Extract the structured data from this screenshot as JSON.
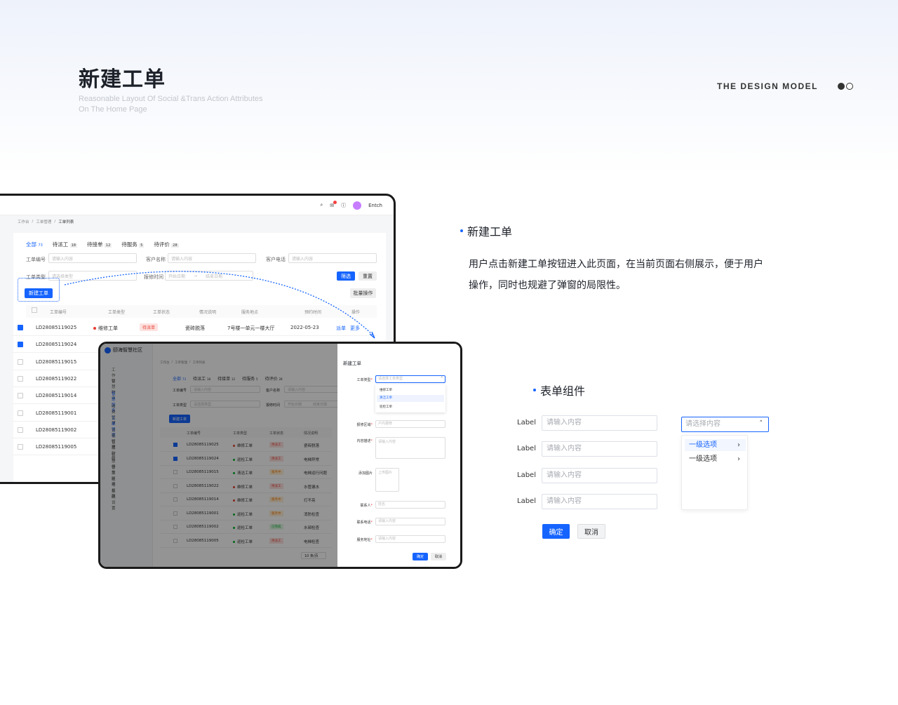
{
  "header": {
    "title": "新建工单",
    "subtitle_line1": "Reasonable Layout Of Social &Trans Action Attributes",
    "subtitle_line2": "On The Home Page",
    "brand": "THE DESIGN MODEL",
    "brand_dot_colors": [
      "#333333",
      "#ffffff"
    ]
  },
  "section1": {
    "title": "新建工单",
    "desc_line1": "用户点击新建工单按钮进入此页面，在当前页面右侧展示，便于用户",
    "desc_line2": "操作，同时也规避了弹窗的局限性。"
  },
  "section2": {
    "title": "表单组件"
  },
  "colors": {
    "accent": "#1664ff"
  },
  "screen1": {
    "user": "Entch",
    "breadcrumb": [
      "工作台",
      "工单管理",
      "工单列表"
    ],
    "tabs": [
      {
        "label": "全部",
        "count": "73"
      },
      {
        "label": "待派工",
        "count": "18"
      },
      {
        "label": "待接单",
        "count": "12"
      },
      {
        "label": "待服务",
        "count": "5"
      },
      {
        "label": "待评价",
        "count": "28"
      }
    ],
    "filters": {
      "order_no": "工单编号",
      "customer": "客户名称",
      "phone": "客户电话",
      "type": "工单类型",
      "time": "报修时间",
      "placeholder": "请输入内容",
      "select_placeholder": "请选择类型",
      "start": "开始日期",
      "end": "结束日期",
      "sep": "→"
    },
    "buttons": {
      "filter": "筛选",
      "reset": "重置",
      "new": "新建工单",
      "batch": "批量操作"
    },
    "columns": [
      "工单编号",
      "工单类型",
      "工单状态",
      "情况说明",
      "服务地点",
      "预约时间",
      "操作"
    ],
    "rows": [
      {
        "id": "LD28085119025",
        "type": "维修工单",
        "status": "待派单",
        "desc": "瓷砖脱落",
        "place": "7号楼一单元一楼大厅",
        "date": "2022-05-23",
        "op1": "派单",
        "op2": "更多",
        "checked": true
      },
      {
        "id": "LD28085119024",
        "checked": true
      },
      {
        "id": "LD28085119015",
        "checked": false
      },
      {
        "id": "LD28085119022",
        "checked": false
      },
      {
        "id": "LD28085119014",
        "checked": false
      },
      {
        "id": "LD28085119001",
        "checked": false
      },
      {
        "id": "LD28085119002",
        "checked": false
      },
      {
        "id": "LD28085119005",
        "checked": false
      }
    ]
  },
  "screen2": {
    "app": "颐海智慧社区",
    "nav": [
      "工作台",
      "智慧物业",
      "智慧服务",
      "收费管理",
      "工单管理",
      "访客管理",
      "智慧物联",
      "智慧停车",
      "智慧环境",
      "账号权限",
      "系统设置"
    ],
    "breadcrumb": [
      "工作台",
      "工单管理",
      "工单列表"
    ],
    "tabs": [
      {
        "label": "全部",
        "count": "73"
      },
      {
        "label": "待派工",
        "count": "18"
      },
      {
        "label": "待接单",
        "count": "12"
      },
      {
        "label": "待服务",
        "count": "5"
      },
      {
        "label": "待评价",
        "count": "28"
      }
    ],
    "filters": {
      "order_no": "工单编号",
      "customer": "客户名称",
      "type": "工单类型",
      "time": "报修时间",
      "placeholder": "请输入内容",
      "select_placeholder": "请选择类型",
      "start": "开始日期",
      "end": "结束日期"
    },
    "new_button": "新建工单",
    "columns": [
      "工单编号",
      "工单类型",
      "工单状态",
      "情况说明"
    ],
    "rows": [
      {
        "id": "LD28085119025",
        "type": "维修工单",
        "status": "待派工",
        "desc": "瓷砖脱落",
        "checked": true,
        "dot": "#e63f32",
        "tag_bg": "#fde2e0",
        "tag_fg": "#e63f32"
      },
      {
        "id": "LD28085119024",
        "type": "巡检工单",
        "status": "待派工",
        "desc": "电梯异常",
        "checked": true,
        "dot": "#00b42a",
        "tag_bg": "#fde2e0",
        "tag_fg": "#e63f32"
      },
      {
        "id": "LD28085119015",
        "type": "清洁工单",
        "status": "服务中",
        "desc": "电梯运行问题",
        "checked": false,
        "dot": "#00b42a",
        "tag_bg": "#fff0d6",
        "tag_fg": "#ff7d00"
      },
      {
        "id": "LD28085119022",
        "type": "维修工单",
        "status": "待派工",
        "desc": "水管漏水",
        "checked": false,
        "dot": "#e63f32",
        "tag_bg": "#fde2e0",
        "tag_fg": "#e63f32"
      },
      {
        "id": "LD28085119014",
        "type": "维修工单",
        "status": "服务中",
        "desc": "灯不亮",
        "checked": false,
        "dot": "#e63f32",
        "tag_bg": "#fff0d6",
        "tag_fg": "#ff7d00"
      },
      {
        "id": "LD28085119001",
        "type": "巡检工单",
        "status": "服务中",
        "desc": "消防检查",
        "checked": false,
        "dot": "#00b42a",
        "tag_bg": "#fff0d6",
        "tag_fg": "#ff7d00"
      },
      {
        "id": "LD28085119002",
        "type": "巡检工单",
        "status": "已完成",
        "desc": "水阀检查",
        "checked": false,
        "dot": "#00b42a",
        "tag_bg": "#e3f7e6",
        "tag_fg": "#00b42a"
      },
      {
        "id": "LD28085119005",
        "type": "巡检工单",
        "status": "待派工",
        "desc": "电梯检查",
        "checked": false,
        "dot": "#00b42a",
        "tag_bg": "#fde2e0",
        "tag_fg": "#e63f32"
      }
    ],
    "pager": "10 条/页",
    "drawer": {
      "title": "新建工单",
      "type_label": "工单类型",
      "type_placeholder": "请选择工单类型",
      "options": [
        "维修工单",
        "清洁工单",
        "巡检工单"
      ],
      "area_label": "报修区域",
      "area_value": "户内报修",
      "desc_label": "内容描述",
      "desc_placeholder": "请输入内容",
      "img_label": "添加图片",
      "img_hint": "上传图片",
      "contact_label": "联系人",
      "contact_placeholder": "姓名",
      "phone_label": "联系电话",
      "phone_placeholder": "请输入内容",
      "addr_label": "服务地址",
      "addr_placeholder": "请输入内容",
      "ok": "确定",
      "cancel": "取消"
    }
  },
  "form": {
    "label": "Label",
    "placeholder": "请输入内容",
    "select_placeholder": "请选择内容",
    "options": [
      "一级选项",
      "一级选项"
    ],
    "ok": "确定",
    "cancel": "取消"
  }
}
